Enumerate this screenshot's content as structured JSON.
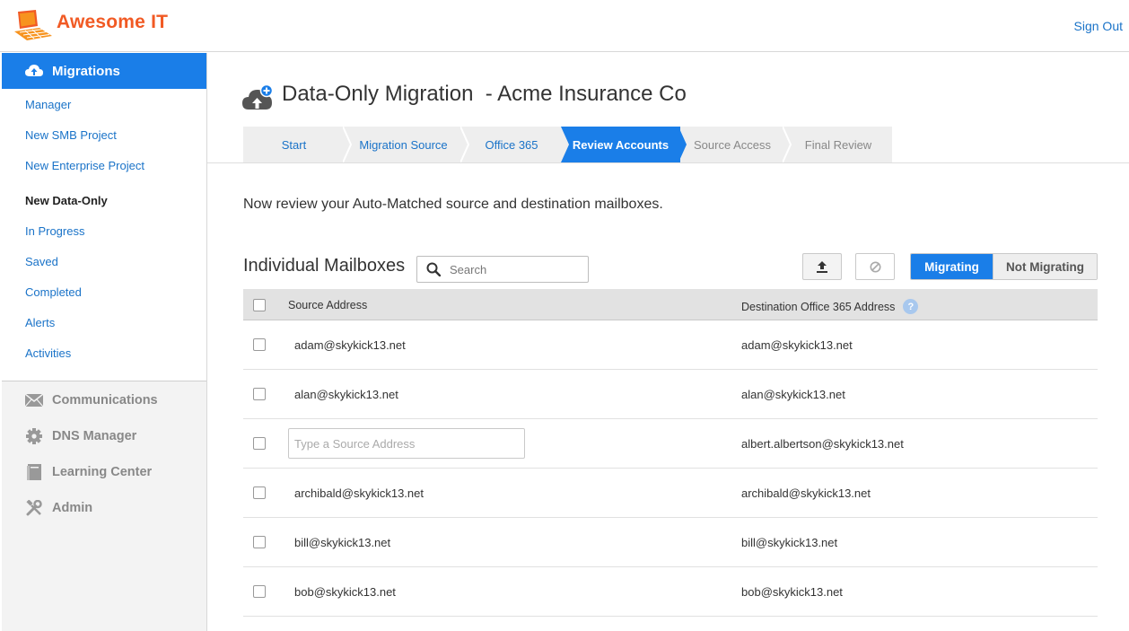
{
  "header": {
    "brand": "Awesome IT",
    "sign_out": "Sign Out"
  },
  "sidebar": {
    "active_section": "Migrations",
    "links": [
      "Manager",
      "New SMB Project",
      "New Enterprise Project",
      "New Data-Only",
      "In Progress",
      "Saved",
      "Completed",
      "Alerts",
      "Activities"
    ],
    "current_link": "New Data-Only",
    "sections": [
      "Communications",
      "DNS Manager",
      "Learning Center",
      "Admin"
    ]
  },
  "page": {
    "title": "Data-Only Migration  - Acme Insurance Co",
    "steps": [
      "Start",
      "Migration Source",
      "Office 365",
      "Review Accounts",
      "Source Access",
      "Final Review"
    ],
    "active_step": "Review Accounts",
    "intro": "Now review your Auto-Matched source and destination mailboxes."
  },
  "mailboxes": {
    "title": "Individual Mailboxes",
    "search_placeholder": "Search",
    "toggle": {
      "on": "Migrating",
      "off": "Not Migrating"
    },
    "columns": {
      "source": "Source Address",
      "destination": "Destination Office 365 Address",
      "help": "?"
    },
    "source_placeholder": "Type a Source Address",
    "rows": [
      {
        "source": "adam@skykick13.net",
        "destination": "adam@skykick13.net"
      },
      {
        "source": "alan@skykick13.net",
        "destination": "alan@skykick13.net"
      },
      {
        "source": "",
        "destination": "albert.albertson@skykick13.net"
      },
      {
        "source": "archibald@skykick13.net",
        "destination": "archibald@skykick13.net"
      },
      {
        "source": "bill@skykick13.net",
        "destination": "bill@skykick13.net"
      },
      {
        "source": "bob@skykick13.net",
        "destination": "bob@skykick13.net"
      }
    ]
  },
  "colors": {
    "accent": "#1a7ee8",
    "link": "#1a73c8",
    "brand": "#f15a24"
  }
}
